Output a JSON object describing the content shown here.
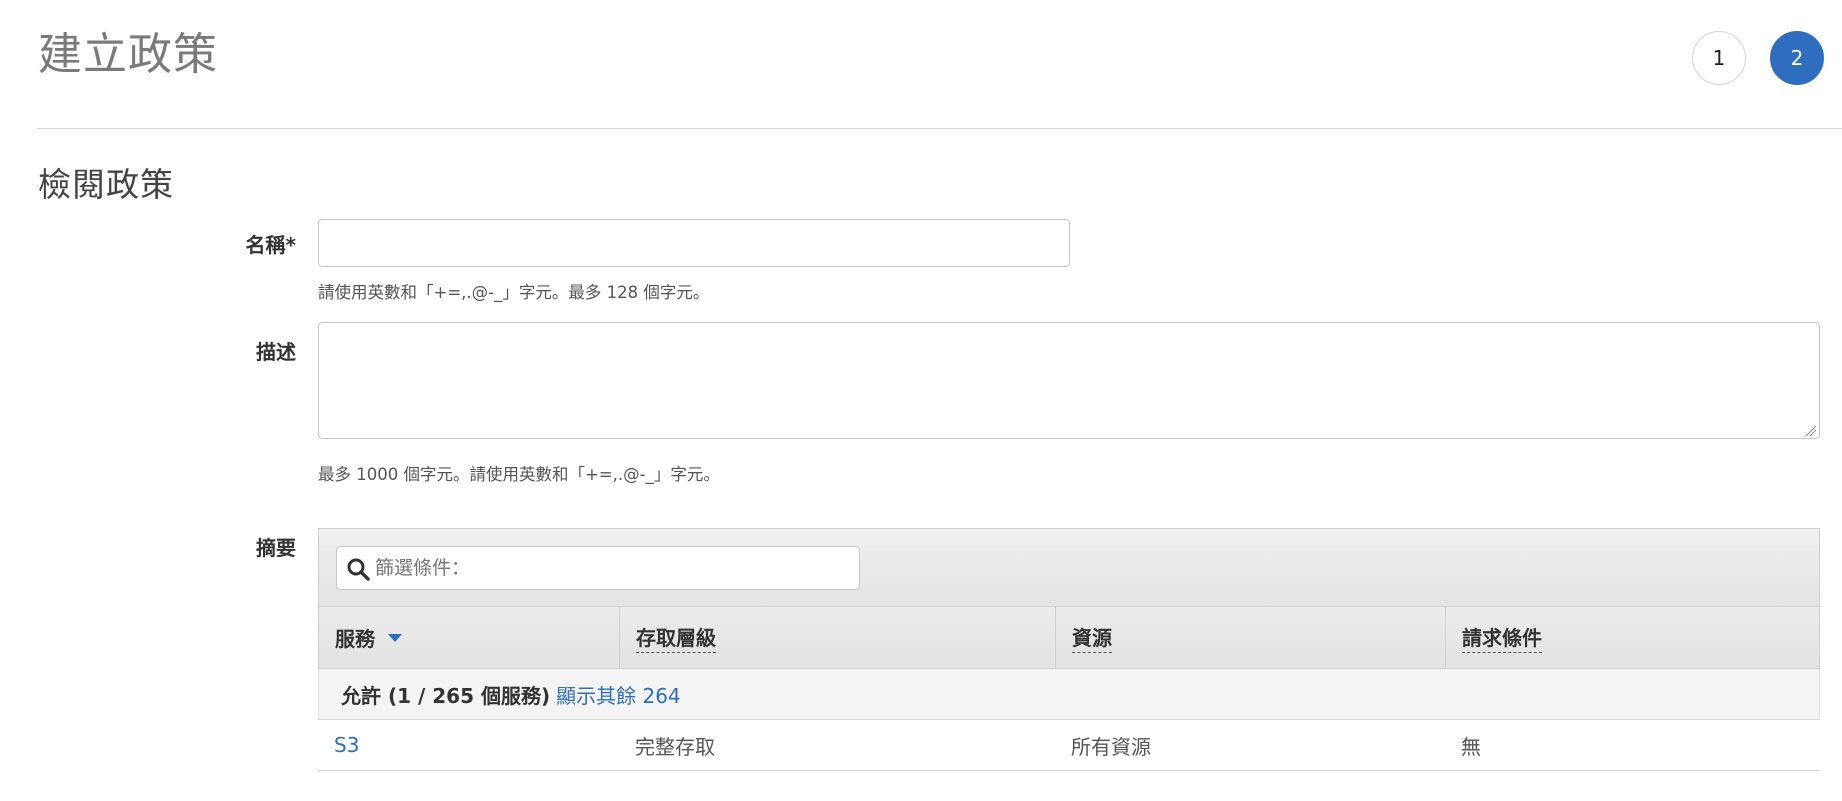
{
  "header": {
    "title": "建立政策",
    "steps": [
      "1",
      "2"
    ],
    "active_step": "2"
  },
  "section": {
    "title": "檢閱政策"
  },
  "form": {
    "name_label": "名稱*",
    "name_value": "",
    "name_hint": "請使用英數和「+=,.@-_」字元。最多 128 個字元。",
    "description_label": "描述",
    "description_value": "",
    "description_hint": "最多 1000 個字元。請使用英數和「+=,.@-_」字元。",
    "summary_label": "摘要"
  },
  "summary": {
    "filter_placeholder": "篩選條件：",
    "columns": [
      "服務",
      "存取層級",
      "資源",
      "請求條件"
    ],
    "group": {
      "label": "允許 (1 / 265 個服務)",
      "show_rest_link": "顯示其餘 264"
    },
    "rows": [
      {
        "service": "S3",
        "access_level": "完整存取",
        "resource": "所有資源",
        "request_condition": "無"
      }
    ]
  },
  "colors": {
    "accent": "#2f6ebf",
    "title_gray": "#7a7a7a"
  },
  "icons": {
    "filter": "search-icon",
    "sort": "caret-down-icon",
    "resize": "resize-grip-icon"
  }
}
